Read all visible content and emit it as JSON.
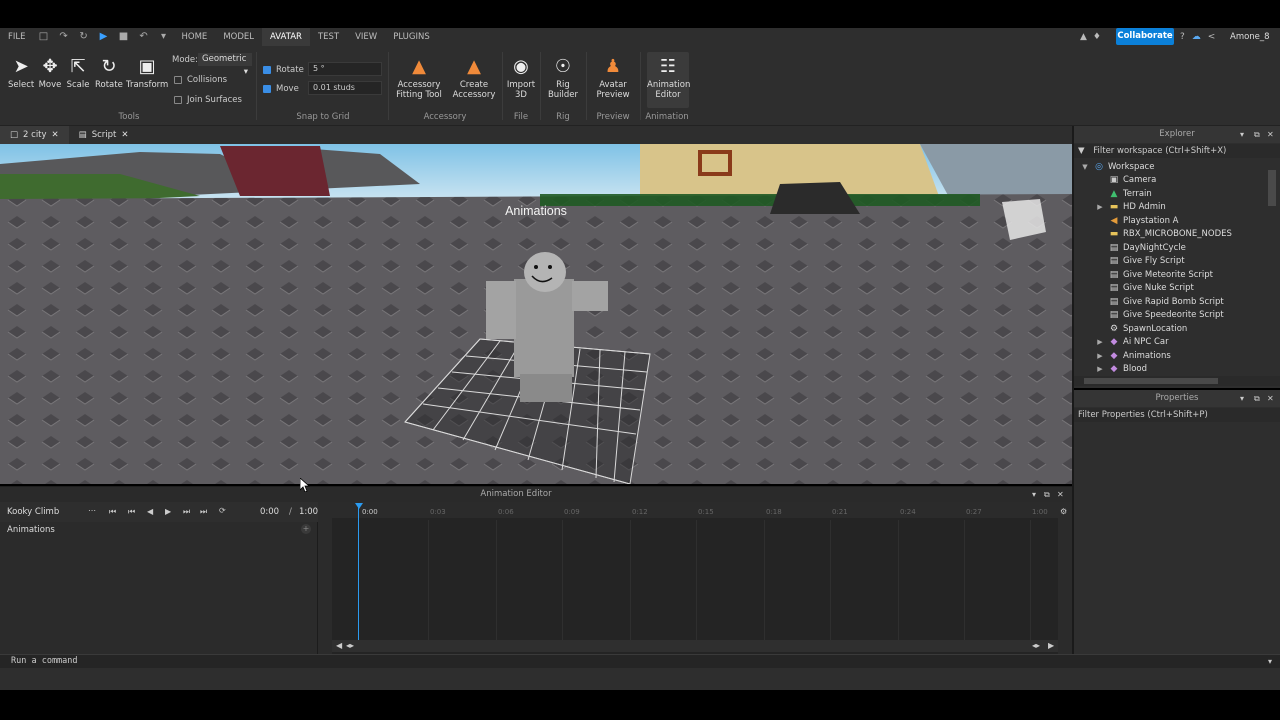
{
  "menu": {
    "file": "FILE",
    "tabs": [
      "HOME",
      "MODEL",
      "AVATAR",
      "TEST",
      "VIEW",
      "PLUGINS"
    ],
    "active_tab": "AVATAR",
    "collaborate": "Collaborate",
    "user": "Amone_8"
  },
  "ribbon": {
    "tools": {
      "select": "Select",
      "move": "Move",
      "scale": "Scale",
      "rotate": "Rotate",
      "transform": "Transform",
      "mode_label": "Mode:",
      "mode_value": "Geometric",
      "collisions": "Collisions",
      "join_surfaces": "Join Surfaces",
      "group": "Tools"
    },
    "snap": {
      "rotate_label": "Rotate",
      "rotate_value": "5 °",
      "move_label": "Move",
      "move_value": "0.01 studs",
      "group": "Snap to Grid"
    },
    "accessory": {
      "fitting_tool_line1": "Accessory",
      "fitting_tool_line2": "Fitting Tool",
      "create_line1": "Create",
      "create_line2": "Accessory",
      "group": "Accessory"
    },
    "file": {
      "import_line1": "Import",
      "import_line2": "3D",
      "group": "File"
    },
    "rig": {
      "builder_line1": "Rig",
      "builder_line2": "Builder",
      "group": "Rig"
    },
    "preview": {
      "avatar_line1": "Avatar",
      "avatar_line2": "Preview",
      "group": "Preview"
    },
    "animation": {
      "editor_line1": "Animation",
      "editor_line2": "Editor",
      "group": "Animation"
    }
  },
  "doc_tabs": [
    "2 city",
    "Script"
  ],
  "viewport": {
    "overlay_title": "Animations"
  },
  "anim_editor": {
    "title": "Animation Editor",
    "anim_name": "Kooky Climb",
    "time_current": "0:00",
    "time_sep": "/",
    "time_total": "1:00",
    "track_label": "Animations",
    "ticks": [
      "0:00",
      "0:03",
      "0:06",
      "0:09",
      "0:12",
      "0:15",
      "0:18",
      "0:21",
      "0:24",
      "0:27",
      "1:00"
    ]
  },
  "explorer": {
    "title": "Explorer",
    "filter_placeholder": "Filter workspace (Ctrl+Shift+X)",
    "items": [
      {
        "label": "Workspace",
        "icon": "globe-icon",
        "depth": 0,
        "expandable": true,
        "expanded": true
      },
      {
        "label": "Camera",
        "icon": "camera-icon",
        "depth": 1,
        "expandable": false
      },
      {
        "label": "Terrain",
        "icon": "terrain-icon",
        "depth": 1,
        "expandable": false
      },
      {
        "label": "HD Admin",
        "icon": "folder-icon",
        "depth": 1,
        "expandable": true
      },
      {
        "label": "Playstation A",
        "icon": "sound-icon",
        "depth": 1,
        "expandable": false
      },
      {
        "label": "RBX_MICROBONE_NODES",
        "icon": "folder-icon",
        "depth": 1,
        "expandable": false
      },
      {
        "label": "DayNightCycle",
        "icon": "script-icon",
        "depth": 1,
        "expandable": false
      },
      {
        "label": "Give Fly Script",
        "icon": "script-icon",
        "depth": 1,
        "expandable": false
      },
      {
        "label": "Give Meteorite Script",
        "icon": "script-icon",
        "depth": 1,
        "expandable": false
      },
      {
        "label": "Give Nuke Script",
        "icon": "script-icon",
        "depth": 1,
        "expandable": false
      },
      {
        "label": "Give Rapid Bomb Script",
        "icon": "script-icon",
        "depth": 1,
        "expandable": false
      },
      {
        "label": "Give Speedeorite Script",
        "icon": "script-icon",
        "depth": 1,
        "expandable": false
      },
      {
        "label": "SpawnLocation",
        "icon": "spawn-icon",
        "depth": 1,
        "expandable": false
      },
      {
        "label": "Ai NPC Car",
        "icon": "model-icon",
        "depth": 1,
        "expandable": true
      },
      {
        "label": "Animations",
        "icon": "model-icon",
        "depth": 1,
        "expandable": true
      },
      {
        "label": "Blood",
        "icon": "model-icon",
        "depth": 1,
        "expandable": true
      }
    ]
  },
  "properties": {
    "title": "Properties",
    "filter_placeholder": "Filter Properties (Ctrl+Shift+P)"
  },
  "command_bar": {
    "placeholder": "Run a command"
  },
  "colors": {
    "accent": "#0b80d9",
    "playhead": "#2b9bf0",
    "panel_bg": "#2e2e2e"
  }
}
